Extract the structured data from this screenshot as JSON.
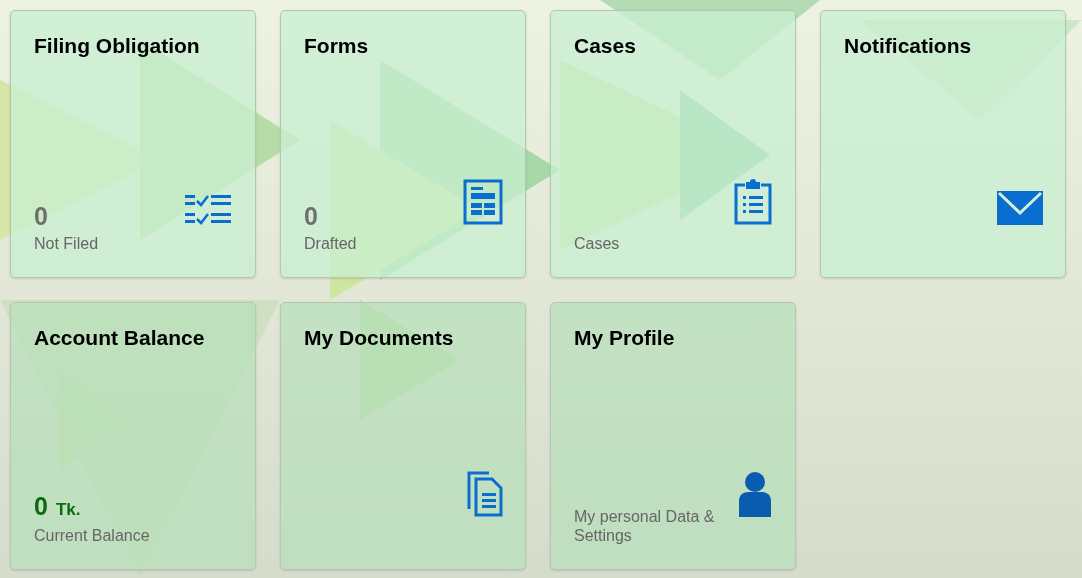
{
  "tiles": [
    {
      "title": "Filing Obligation",
      "kind": "count",
      "number": "0",
      "subtitle": "Not Filed"
    },
    {
      "title": "Forms",
      "kind": "count",
      "number": "0",
      "subtitle": "Drafted"
    },
    {
      "title": "Cases",
      "kind": "plain",
      "subtitle": "Cases"
    },
    {
      "title": "Notifications",
      "kind": "plain"
    },
    {
      "title": "Account Balance",
      "kind": "balance",
      "number": "0",
      "unit": "Tk.",
      "subtitle": "Current Balance"
    },
    {
      "title": "My Documents",
      "kind": "plain"
    },
    {
      "title": "My Profile",
      "kind": "plain",
      "subtitle": "My personal Data & Settings"
    }
  ]
}
